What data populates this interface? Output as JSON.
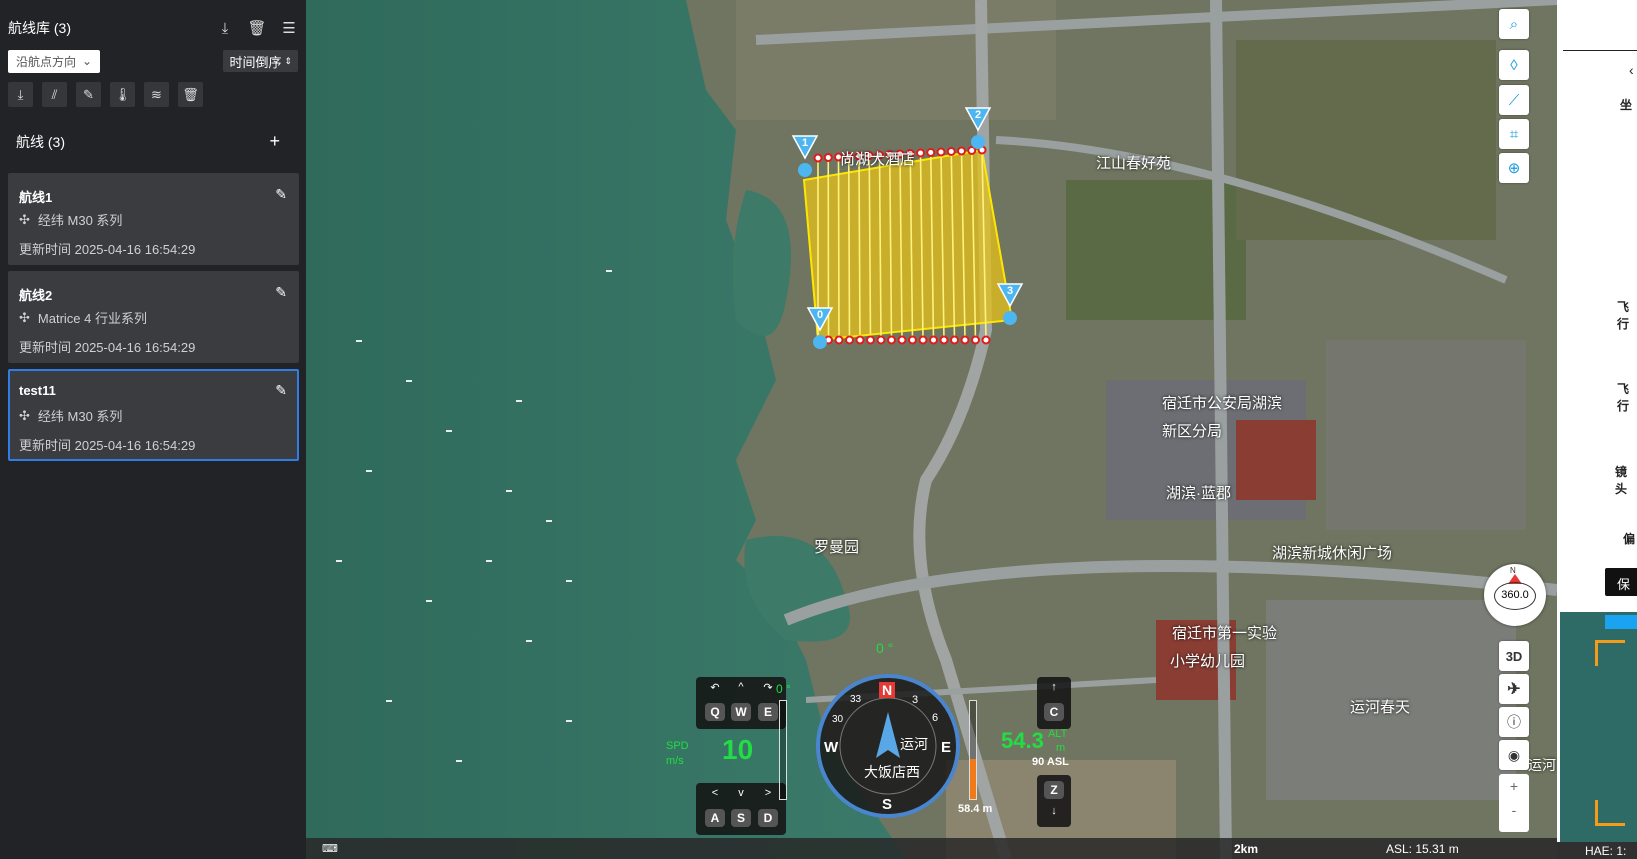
{
  "sidebar": {
    "title": "航线库 (3)",
    "header_icons": [
      "download-icon",
      "trash-icon",
      "select-list-icon"
    ],
    "filter_label": "沿航点方向",
    "sort_label": "时间倒序",
    "tools": [
      "download-icon",
      "road-icon",
      "edit-icon",
      "thermometer-icon",
      "wind-icon",
      "trash-icon"
    ],
    "section_title": "航线 (3)",
    "routes": [
      {
        "name": "航线1",
        "device": "经纬 M30 系列",
        "updated": "更新时间 2025-04-16 16:54:29",
        "active": false
      },
      {
        "name": "航线2",
        "device": "Matrice 4 行业系列",
        "updated": "更新时间 2025-04-16 16:54:29",
        "active": false
      },
      {
        "name": "test11",
        "device": "经纬 M30 系列",
        "updated": "更新时间 2025-04-16 16:54:29",
        "active": true
      }
    ]
  },
  "map": {
    "labels": {
      "hotel": "尚湖大酒店",
      "estate1": "江山春好苑",
      "police1": "宿迁市公安局湖滨",
      "police2": "新区分局",
      "huBin": "湖滨·蓝郡",
      "park": "罗曼园",
      "plaza": "湖滨新城休闲广场",
      "school1": "宿迁市第一实验",
      "school2": "小学幼儿园",
      "canal": "运河春天",
      "canalHotel1": "运河",
      "canalHotel2": "大饭店西",
      "yunhe": "运河"
    },
    "waypoints": [
      "0",
      "1",
      "2",
      "3"
    ],
    "tools": [
      "search-icon",
      "waypoint-icon",
      "line-icon",
      "crop-icon",
      "target-icon"
    ],
    "compass_value": "360.0",
    "compass_n": "N",
    "btn_3d": "3D",
    "zoom_in": "+",
    "zoom_out": "-"
  },
  "hud": {
    "heading_top": "0 °",
    "pitch": "0 °",
    "keys_top": [
      "Q",
      "W",
      "E"
    ],
    "keys_top_arrows": [
      "↶",
      "^",
      "↷"
    ],
    "keys_bottom": [
      "A",
      "S",
      "D"
    ],
    "keys_bottom_arrows": [
      "<",
      "v",
      ">"
    ],
    "spd_label": "SPD",
    "spd_unit": "m/s",
    "spd_value": "10",
    "alt_value": "54.3",
    "alt_label": "ALT",
    "alt_unit": "m",
    "asl_text": "90 ASL",
    "key_c": "C",
    "key_z": "Z",
    "arrow_up": "↑",
    "arrow_down": "↓",
    "height_text": "58.4 m",
    "compass_letters": [
      "N",
      "3",
      "6",
      "E",
      "S",
      "W",
      "30",
      "33"
    ]
  },
  "bottom": {
    "scale": "2km",
    "asl": "ASL: 15.31 m",
    "hae": "HAE: 1:"
  },
  "rpanel": {
    "coord": "坐",
    "fly1": "飞行",
    "fly2": "飞行",
    "lens": "镜头",
    "bias": "偏",
    "save": "保"
  },
  "colors": {
    "route": "#ffe600",
    "waypoint": "#4db6f0",
    "accent": "#2f7ee8",
    "hud_green": "#22dd44"
  }
}
